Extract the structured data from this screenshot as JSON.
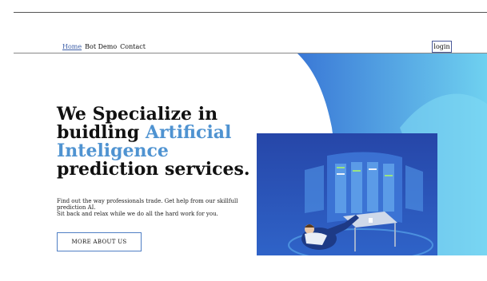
{
  "nav": {
    "items": [
      {
        "label": "Home"
      },
      {
        "label": "Bot Demo"
      },
      {
        "label": "Contact"
      }
    ],
    "login_label": "login"
  },
  "hero": {
    "headline_line1": "We Specialize in",
    "headline_line2a": "buidling ",
    "headline_accent": "Artificial Inteligence",
    "headline_line3": "prediction services.",
    "subtext_line1": "Find out the way professionals trade. Get help from our skillfull prediction AI.",
    "subtext_line2": "Sit back and relax while we do all the hard work for you.",
    "cta_label": "MORE ABOUT US"
  },
  "colors": {
    "accent": "#4f93d1",
    "hero_gradient_start": "#3a78d6",
    "hero_gradient_end": "#6fd1f0",
    "illustration_bg": "#2b4fb3"
  }
}
